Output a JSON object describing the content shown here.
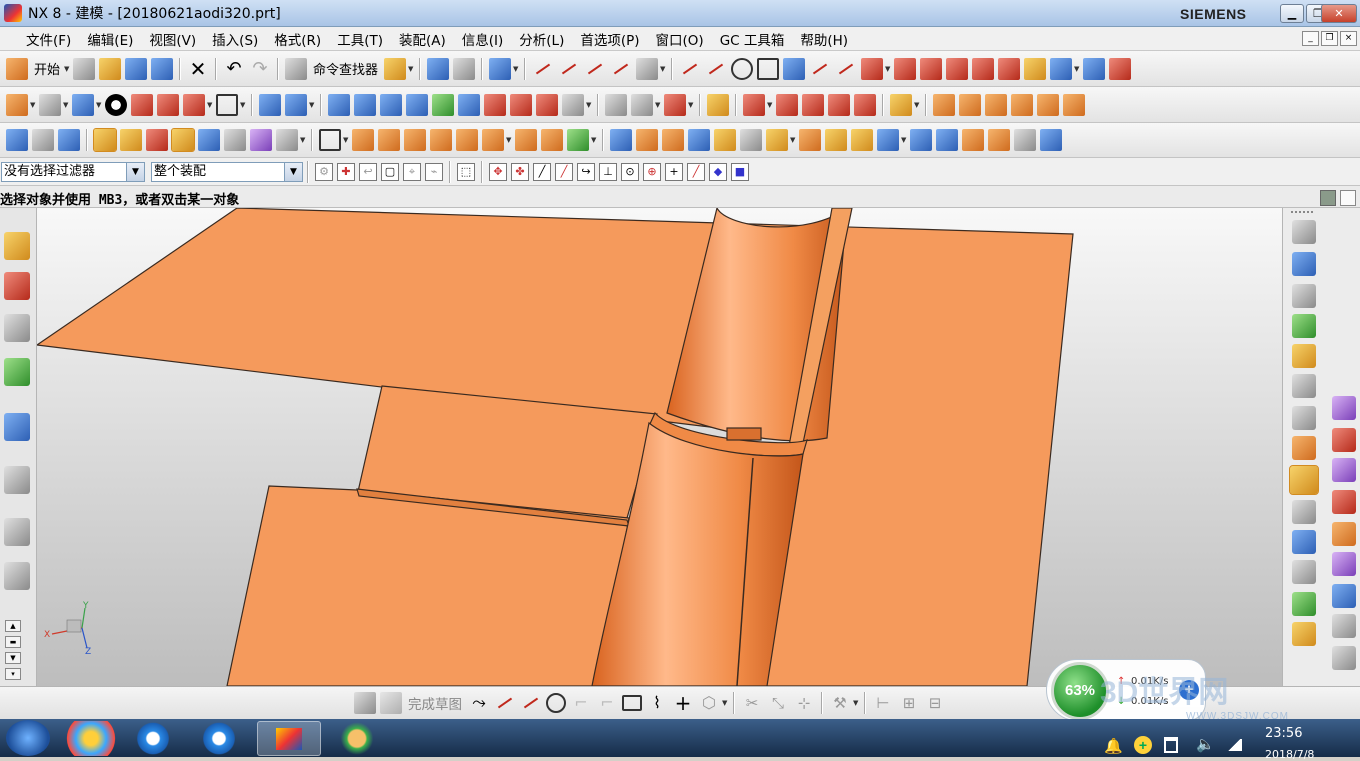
{
  "window": {
    "title": "NX 8 - 建模 - [20180621aodi320.prt]",
    "brand": "SIEMENS",
    "minimize": "▁",
    "restore": "❐",
    "close": "✕"
  },
  "menu": {
    "items": [
      "文件(F)",
      "编辑(E)",
      "视图(V)",
      "插入(S)",
      "格式(R)",
      "工具(T)",
      "装配(A)",
      "信息(I)",
      "分析(L)",
      "首选项(P)",
      "窗口(O)",
      "GC 工具箱",
      "帮助(H)"
    ]
  },
  "toolbar1": {
    "start_label": "开始",
    "command_finder_label": "命令查找器"
  },
  "selection": {
    "filter_value": "没有选择过滤器",
    "scope_value": "整个装配"
  },
  "cue": {
    "text": "选择对象并使用 MB3，或者双击某一对象"
  },
  "sketch_bar": {
    "finish_sketch_label": "完成草图"
  },
  "triad": {
    "x": "X",
    "y": "Y",
    "z": "Z"
  },
  "network_gadget": {
    "percent": "63%",
    "upload": "0.01K/s",
    "download": "0.01K/s",
    "plus": "+"
  },
  "taskbar": {
    "time": "23:56",
    "date": "2018/7/8"
  },
  "watermark": {
    "main": "3D世界网",
    "url": "WWW.3DSJW.COM"
  },
  "colors": {
    "part_orange": "#f59a5c",
    "part_edge": "#3a2a20",
    "background_top": "#f8f8f8",
    "background_bottom": "#bdbdbd"
  }
}
